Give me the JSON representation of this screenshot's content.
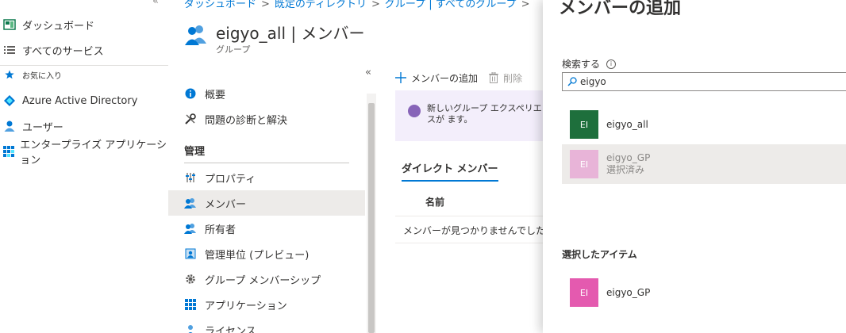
{
  "nav": {
    "items": [
      {
        "label": "ダッシュボード",
        "icon": "dashboard-icon"
      },
      {
        "label": "すべてのサービス",
        "icon": "list-icon"
      },
      {
        "label": "お気に入り",
        "icon": "star-icon"
      },
      {
        "label": "Azure Active Directory",
        "icon": "aad-diamond-icon"
      },
      {
        "label": "ユーザー",
        "icon": "user-icon"
      },
      {
        "label": "エンタープライズ アプリケーション",
        "icon": "apps-grid-icon"
      }
    ],
    "collapse_glyph": "«"
  },
  "blade": {
    "breadcrumb": [
      "ダッシュボード",
      "既定のディレクトリ",
      "グループ | すべてのグループ"
    ],
    "title": "eigyo_all | メンバー",
    "subtitle": "グループ",
    "menu_collapse_glyph": "«",
    "menu": {
      "top_items": [
        {
          "label": "概要",
          "icon": "info-circle-icon"
        },
        {
          "label": "問題の診断と解決",
          "icon": "wrench-icon"
        }
      ],
      "section_header": "管理",
      "manage_items": [
        {
          "label": "プロパティ",
          "icon": "properties-icon"
        },
        {
          "label": "メンバー",
          "icon": "members-icon"
        },
        {
          "label": "所有者",
          "icon": "owners-icon"
        },
        {
          "label": "管理単位 (プレビュー)",
          "icon": "admin-unit-icon"
        },
        {
          "label": "グループ メンバーシップ",
          "icon": "gear-icon"
        },
        {
          "label": "アプリケーション",
          "icon": "apps-grid-icon"
        },
        {
          "label": "ライセンス",
          "icon": "license-icon"
        }
      ]
    },
    "toolbar": {
      "add_label": "メンバーの追加",
      "delete_label": "削除"
    },
    "banner_text": "新しいグループ エクスペリエンスが ます。",
    "tab_label": "ダイレクト メンバー",
    "column_name": "名前",
    "empty_message": "メンバーが見つかりませんでした"
  },
  "panel": {
    "title": "メンバーの追加",
    "search_label": "検索する",
    "search_value": "eigyo",
    "results": [
      {
        "initials": "EI",
        "name": "eigyo_all",
        "status": "",
        "color": "#1e6f3c"
      },
      {
        "initials": "EI",
        "name": "eigyo_GP",
        "status": "選択済み",
        "color": "#e8b4d8"
      }
    ],
    "selected_header": "選択したアイテム",
    "selected_items": [
      {
        "initials": "EI",
        "name": "eigyo_GP",
        "color": "#e45aaf"
      }
    ]
  }
}
